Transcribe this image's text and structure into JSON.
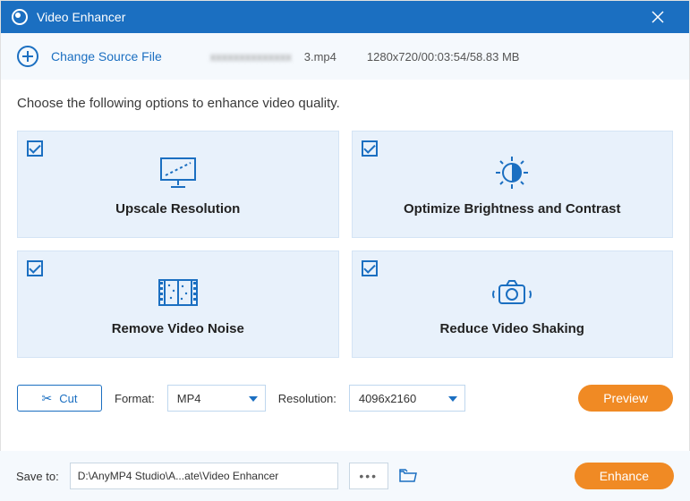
{
  "window": {
    "title": "Video Enhancer"
  },
  "source": {
    "change_link": "Change Source File",
    "filename_prefix_blurred": "xxxxxxxxxxxxxx",
    "filename_visible": "3.mp4",
    "meta": "1280x720/00:03:54/58.83 MB"
  },
  "instruction": "Choose the following options to enhance video quality.",
  "cards": {
    "upscale": {
      "label": "Upscale Resolution",
      "checked": true
    },
    "brightness": {
      "label": "Optimize Brightness and Contrast",
      "checked": true
    },
    "noise": {
      "label": "Remove Video Noise",
      "checked": true
    },
    "shaking": {
      "label": "Reduce Video Shaking",
      "checked": true
    }
  },
  "controls": {
    "cut_label": "Cut",
    "format_label": "Format:",
    "format_value": "MP4",
    "resolution_label": "Resolution:",
    "resolution_value": "4096x2160",
    "preview_label": "Preview"
  },
  "footer": {
    "save_label": "Save to:",
    "save_path": "D:\\AnyMP4 Studio\\A...ate\\Video Enhancer",
    "enhance_label": "Enhance"
  }
}
